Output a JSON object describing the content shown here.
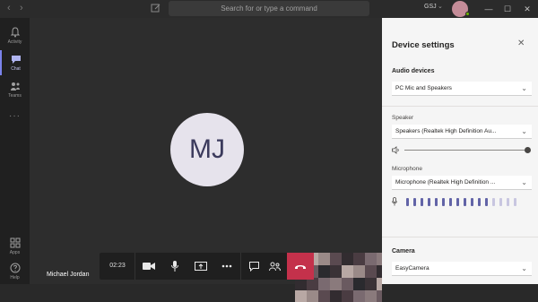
{
  "titlebar": {
    "search_placeholder": "Search for or type a command",
    "org": "GSJ",
    "back_arrow": "‹",
    "forward_arrow": "›",
    "org_chevron": "⌄",
    "minimize": "—",
    "maximize": "☐",
    "close": "✕"
  },
  "rail": {
    "items": [
      {
        "label": "Activity",
        "icon": "bell-icon"
      },
      {
        "label": "Chat",
        "icon": "chat-icon"
      },
      {
        "label": "Teams",
        "icon": "teams-icon"
      },
      {
        "label": "Apps",
        "icon": "apps-icon"
      },
      {
        "label": "Help",
        "icon": "help-icon"
      }
    ],
    "more": "···"
  },
  "call": {
    "initials": "MJ",
    "participant_name": "Michael Jordan",
    "timer": "02:23"
  },
  "controls": [
    {
      "name": "camera-button",
      "icon": "video-camera-icon"
    },
    {
      "name": "mic-button",
      "icon": "microphone-icon"
    },
    {
      "name": "share-button",
      "icon": "share-screen-icon"
    },
    {
      "name": "more-actions-button",
      "icon": "more-icon"
    },
    {
      "name": "chat-toggle-button",
      "icon": "conversation-icon"
    },
    {
      "name": "participants-button",
      "icon": "people-icon"
    },
    {
      "name": "hang-up-button",
      "icon": "hang-up-icon"
    }
  ],
  "device_settings": {
    "title": "Device settings",
    "close": "✕",
    "audio_heading": "Audio devices",
    "audio_device": "PC Mic and Speakers",
    "speaker_label": "Speaker",
    "speaker_device": "Speakers (Realtek High Definition Au...",
    "speaker_volume": 1.0,
    "microphone_label": "Microphone",
    "microphone_device": "Microphone (Realtek High Definition ...",
    "mic_level_segments_active": 12,
    "mic_level_segments_total": 16,
    "camera_heading": "Camera",
    "camera_device": "EasyCamera",
    "chevron": "⌄"
  },
  "colors": {
    "accent": "#7b83eb",
    "hangup": "#c4314b",
    "mic_level_active": "#6264a7",
    "mic_level_inactive": "#c8c6e0"
  }
}
